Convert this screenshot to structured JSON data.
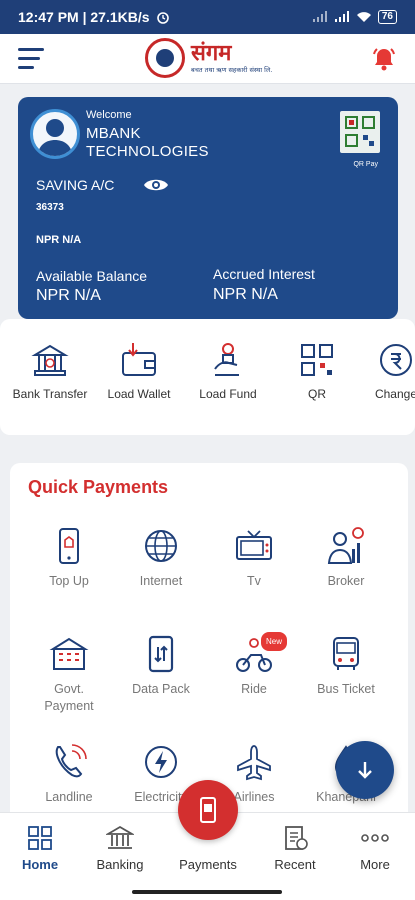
{
  "status_bar": {
    "time_speed": "12:47 PM | 27.1KB/s",
    "battery": "76"
  },
  "header": {
    "logo_name": "संगम",
    "logo_sub": "बचत तथा ऋण सहकारी संस्था लि.",
    "colors": {
      "primary": "#1f3f78",
      "accent": "#d32f2f"
    }
  },
  "account": {
    "welcome": "Welcome",
    "name_line1": "MBANK",
    "name_line2": "TECHNOLOGIES",
    "qr_label": "QR Pay",
    "type": "SAVING A/C",
    "number": "36373",
    "npr": "NPR N/A",
    "available_label": "Available Balance",
    "available_value": "NPR N/A",
    "interest_label": "Accrued Interest",
    "interest_value": "NPR N/A"
  },
  "actions": [
    {
      "label": "Bank Transfer",
      "icon": "bank-icon"
    },
    {
      "label": "Load Wallet",
      "icon": "wallet-icon"
    },
    {
      "label": "Load Fund",
      "icon": "fund-icon"
    },
    {
      "label": "QR",
      "icon": "qr-icon"
    },
    {
      "label": "Change",
      "icon": "change-icon"
    }
  ],
  "quick_payments": {
    "title": "Quick Payments",
    "items": [
      {
        "label": "Top Up",
        "icon": "mobile-icon"
      },
      {
        "label": "Internet",
        "icon": "globe-icon"
      },
      {
        "label": "Tv",
        "icon": "tv-icon"
      },
      {
        "label": "Broker",
        "icon": "broker-icon"
      },
      {
        "label": "Govt.",
        "label2": "Payment",
        "icon": "government-icon"
      },
      {
        "label": "Data Pack",
        "icon": "data-pack-icon"
      },
      {
        "label": "Ride",
        "icon": "ride-icon",
        "badge": "New"
      },
      {
        "label": "Bus Ticket",
        "icon": "bus-icon"
      },
      {
        "label": "Landline",
        "icon": "phone-icon"
      },
      {
        "label": "Electricity",
        "icon": "electricity-icon"
      },
      {
        "label": "Airlines",
        "icon": "airplane-icon"
      },
      {
        "label": "Khanepani",
        "icon": "water-icon"
      }
    ]
  },
  "bottom_nav": {
    "home": "Home",
    "banking": "Banking",
    "payments": "Payments",
    "recent": "Recent",
    "more": "More"
  }
}
